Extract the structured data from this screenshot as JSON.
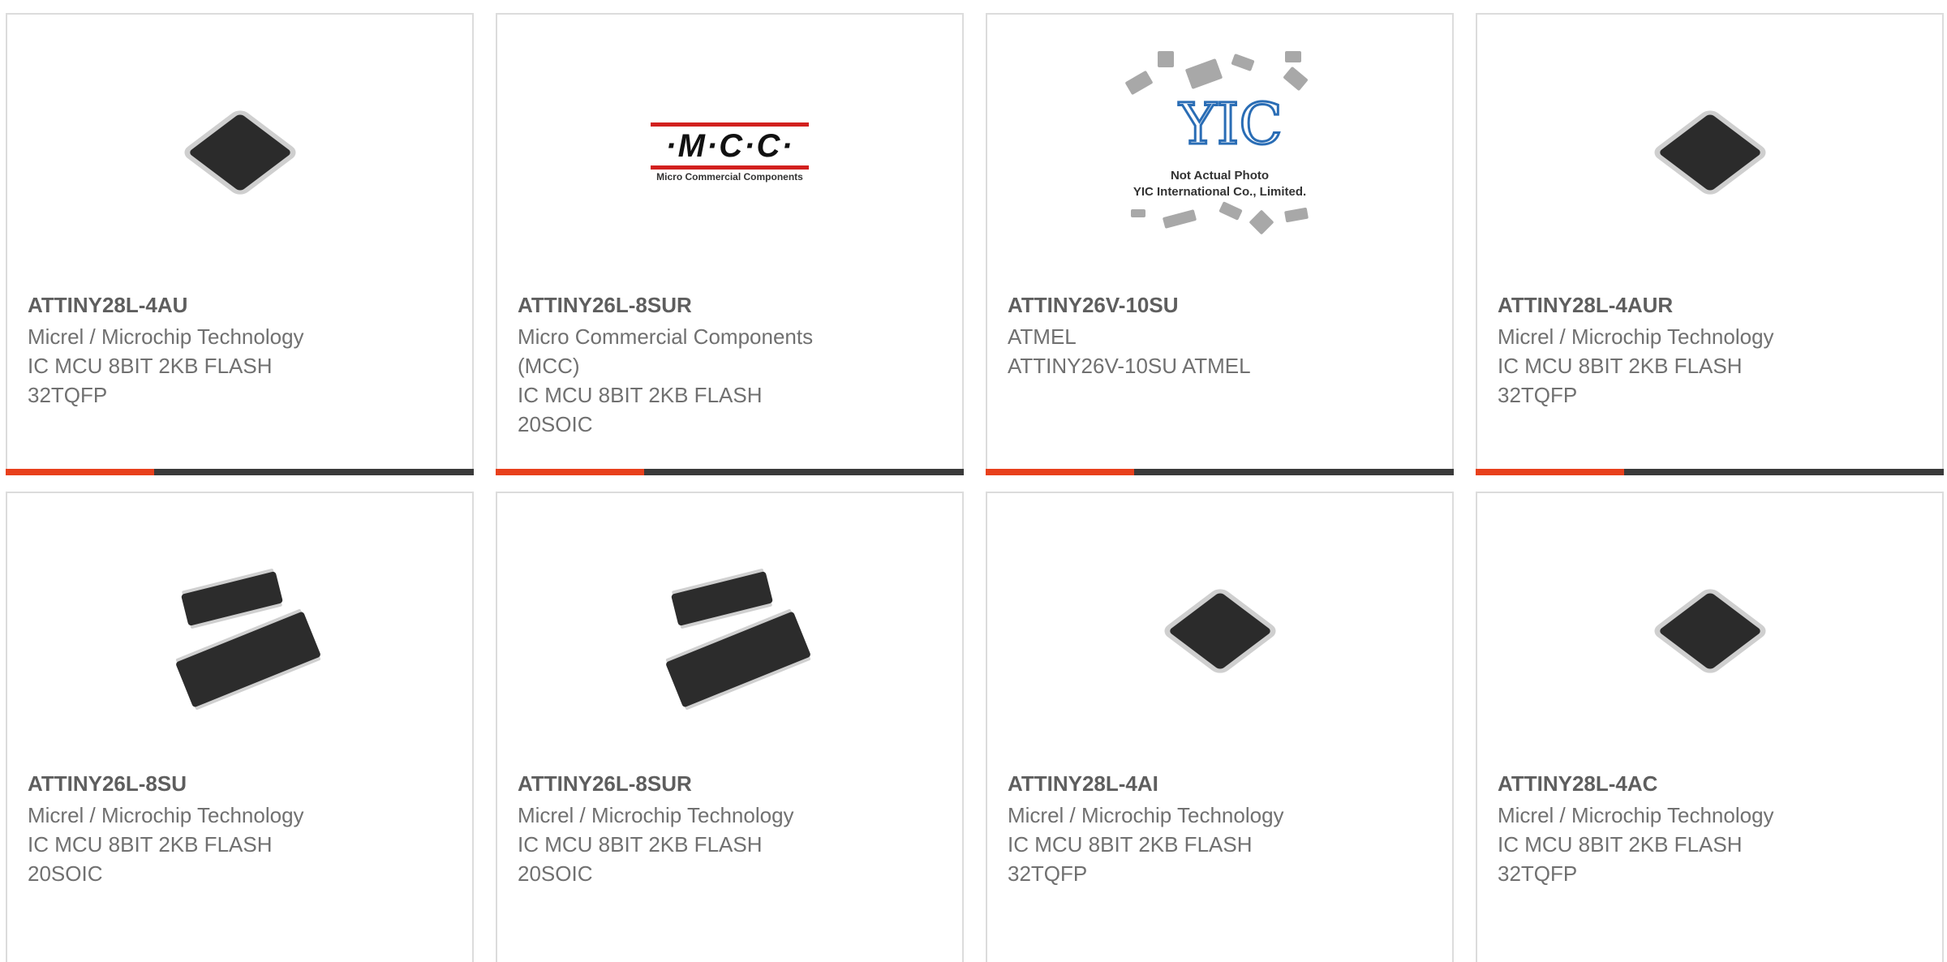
{
  "products": [
    {
      "part": "ATTINY28L-4AU",
      "lines": [
        "Micrel / Microchip Technology",
        "IC MCU 8BIT 2KB FLASH",
        "32TQFP"
      ],
      "image": "qfp-chip"
    },
    {
      "part": "ATTINY26L-8SUR",
      "lines": [
        "Micro Commercial Components",
        "(MCC)",
        "IC MCU 8BIT 2KB FLASH",
        "20SOIC"
      ],
      "image": "mcc-logo"
    },
    {
      "part": "ATTINY26V-10SU",
      "lines": [
        "ATMEL",
        "ATTINY26V-10SU ATMEL"
      ],
      "image": "yic-not-actual-photo"
    },
    {
      "part": "ATTINY28L-4AUR",
      "lines": [
        "Micrel / Microchip Technology",
        "IC MCU 8BIT 2KB FLASH",
        "32TQFP"
      ],
      "image": "qfp-chip"
    },
    {
      "part": "ATTINY26L-8SU",
      "lines": [
        "Micrel / Microchip Technology",
        "IC MCU 8BIT 2KB FLASH",
        "20SOIC"
      ],
      "image": "soic-chip"
    },
    {
      "part": "ATTINY26L-8SUR",
      "lines": [
        "Micrel / Microchip Technology",
        "IC MCU 8BIT 2KB FLASH",
        "20SOIC"
      ],
      "image": "soic-chip"
    },
    {
      "part": "ATTINY28L-4AI",
      "lines": [
        "Micrel / Microchip Technology",
        "IC MCU 8BIT 2KB FLASH",
        "32TQFP"
      ],
      "image": "qfp-chip"
    },
    {
      "part": "ATTINY28L-4AC",
      "lines": [
        "Micrel / Microchip Technology",
        "IC MCU 8BIT 2KB FLASH",
        "32TQFP"
      ],
      "image": "qfp-chip"
    }
  ],
  "mcc_logo": {
    "text": "·M·C·C·",
    "subtitle": "Micro Commercial Components"
  },
  "yic_photo": {
    "mark": "YIC",
    "line1": "Not Actual Photo",
    "line2": "YIC International Co., Limited."
  },
  "colors": {
    "accent": "#e8401c",
    "bar": "#3a3a3a",
    "border": "#dcdcdc"
  }
}
